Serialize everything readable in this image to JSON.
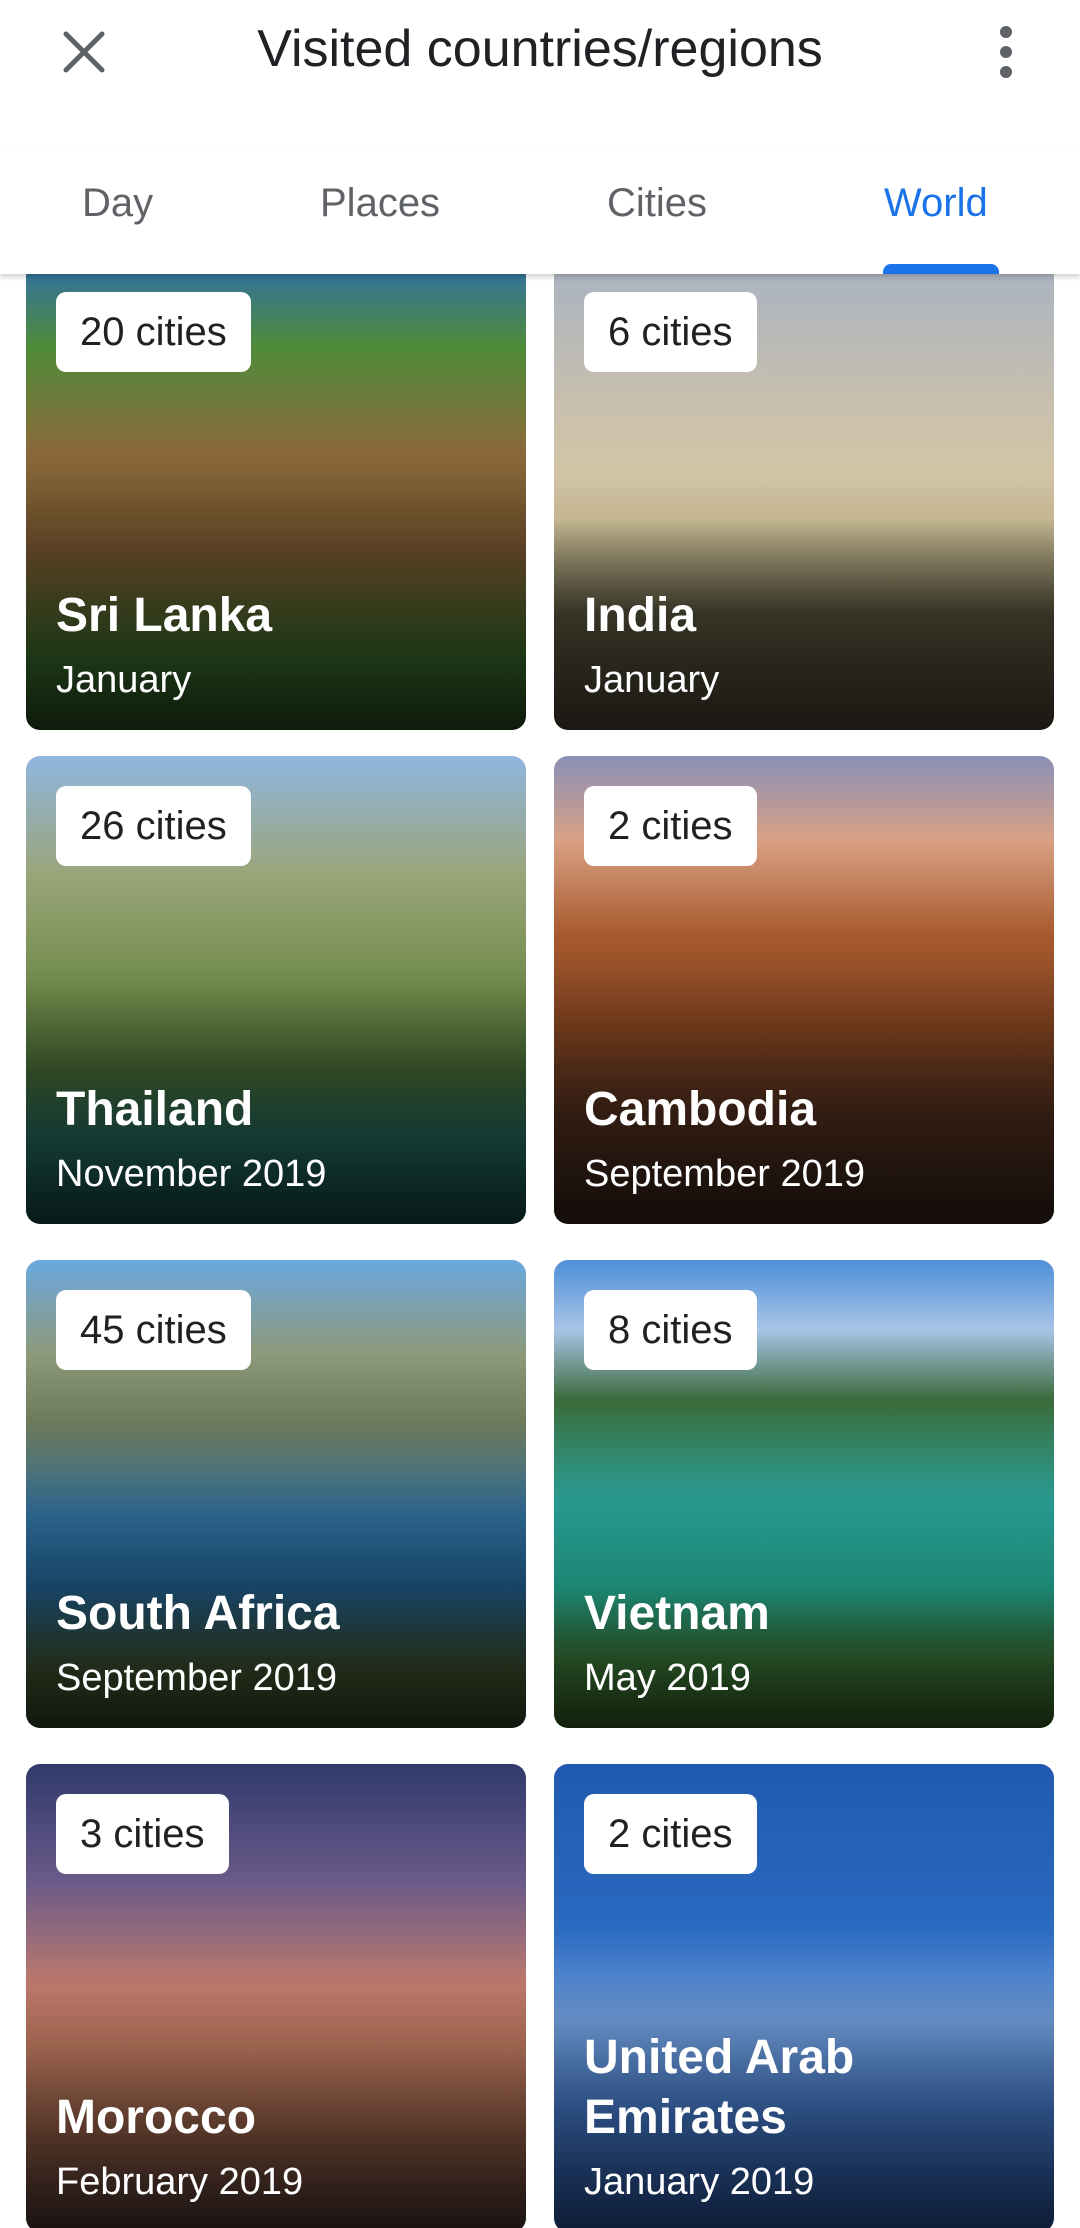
{
  "header": {
    "title": "Visited countries/regions",
    "close_icon": "close-icon",
    "more_icon": "more-vert-icon"
  },
  "tabs": [
    {
      "label": "Day",
      "active": false
    },
    {
      "label": "Places",
      "active": false
    },
    {
      "label": "Cities",
      "active": false
    },
    {
      "label": "World",
      "active": true
    }
  ],
  "colors": {
    "accent": "#1a73e8",
    "text": "#202124",
    "muted": "#5f6368"
  },
  "countries": [
    {
      "name": "Sri Lanka",
      "date": "January",
      "cities": "20 cities"
    },
    {
      "name": "India",
      "date": "January",
      "cities": "6 cities"
    },
    {
      "name": "Thailand",
      "date": "November 2019",
      "cities": "26 cities"
    },
    {
      "name": "Cambodia",
      "date": "September 2019",
      "cities": "2 cities"
    },
    {
      "name": "South Africa",
      "date": "September 2019",
      "cities": "45 cities"
    },
    {
      "name": "Vietnam",
      "date": "May 2019",
      "cities": "8 cities"
    },
    {
      "name": "Morocco",
      "date": "February 2019",
      "cities": "3 cities"
    },
    {
      "name": "United Arab Emirates",
      "date": "January 2019",
      "cities": "2 cities"
    }
  ]
}
